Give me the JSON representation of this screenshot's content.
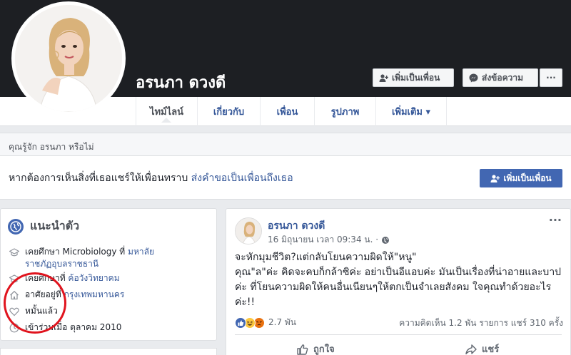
{
  "profile": {
    "name": "อรนภา ดวงดี"
  },
  "cover_actions": {
    "add_friend": "เพิ่มเป็นเพื่อน",
    "message": "ส่งข้อความ",
    "more": "···"
  },
  "tabs": [
    {
      "label": "ไทม์ไลน์"
    },
    {
      "label": "เกี่ยวกับ"
    },
    {
      "label": "เพื่อน"
    },
    {
      "label": "รูปภาพ"
    },
    {
      "label": "เพิ่มเติม ▾"
    }
  ],
  "know_card": {
    "heading": "คุณรู้จัก อรนภา หรือไม่",
    "text": "หากต้องการเห็นสิ่งที่เธอแชร์ให้เพื่อนทราบ ",
    "link": "ส่งคำขอเป็นเพื่อนถึงเธอ",
    "button": "เพิ่มเป็นเพื่อน"
  },
  "intro": {
    "title": "แนะนำตัว",
    "items": [
      {
        "prefix": "เคยศึกษา Microbiology ที่ ",
        "link": "มหาลัยราชภัฏอุบลราชธานี"
      },
      {
        "prefix": "เคยศึกษาที่ ",
        "link": "ค้อวังวิทยาคม"
      },
      {
        "prefix": "อาศัยอยู่ที่ ",
        "link": "กรุงเทพมหานคร"
      },
      {
        "prefix": "หมั้นแล้ว",
        "link": ""
      },
      {
        "prefix": "เข้าร่วมเมื่อ ตุลาคม 2010",
        "link": ""
      }
    ]
  },
  "post": {
    "author": "อรนภา ดวงดี",
    "time": "16 มิถุนายน เวลา 09:34 น. ·",
    "more": "···",
    "body": "จะหักมุมชีวิต?แต่กลับโยนความผิดให้\"หนู\"\nคุณ\"ล\"ค่ะ คิดจะคบก็กล้าซิค่ะ อย่าเป็นอีแอบค่ะ มันเป็นเรื่องที่น่าอายและบาปค่ะ ที่โยนความผิดให้คนอื่นเนียนๆให้ตกเป็นจำเลยสังคม ใจคุณทำด้วยอะไรค่ะ!!",
    "reaction_count": "2.7 พัน",
    "stats": "ความคิดเห็น 1.2 พัน รายการ  แชร์ 310 ครั้ง",
    "like_label": "ถูกใจ",
    "share_label": "แชร์"
  },
  "colors": {
    "brand": "#4267b2",
    "link": "#365899",
    "cover": "#1d1f23",
    "highlight": "#e0141e"
  }
}
